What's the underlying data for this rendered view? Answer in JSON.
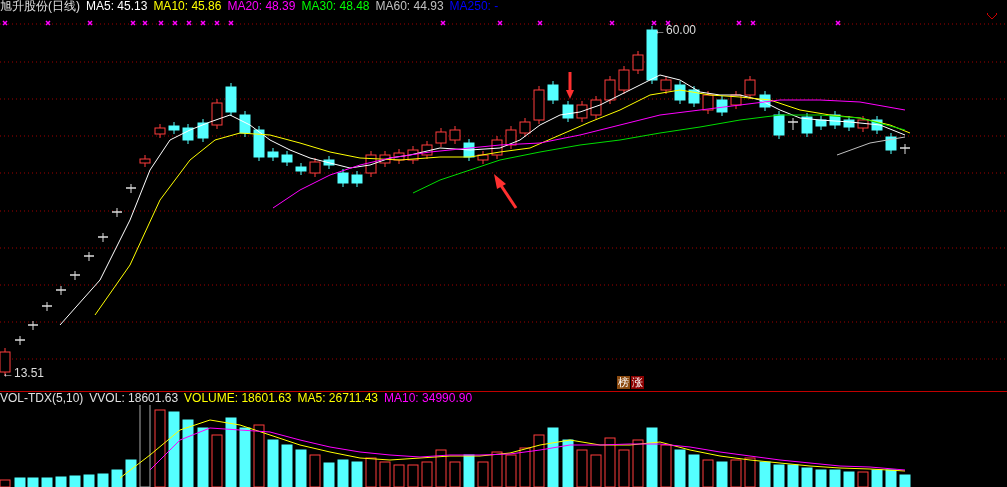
{
  "price_panel": {
    "title": "旭升股份(日线)",
    "indicators": [
      {
        "label": "MA5: 45.13",
        "color": "#ffffff"
      },
      {
        "label": "MA10: 45.86",
        "color": "#ffff00"
      },
      {
        "label": "MA20: 48.39",
        "color": "#ff00ff"
      },
      {
        "label": "MA30: 48.48",
        "color": "#00ff00"
      },
      {
        "label": "MA60: 44.93",
        "color": "#c0c0c0"
      },
      {
        "label": "MA250: -",
        "color": "#0000ff"
      }
    ],
    "high_label": "←60.00",
    "low_label": "←13.51",
    "badges": [
      {
        "text": "榜",
        "color": "#8b4a10"
      },
      {
        "text": "涨",
        "color": "#8b0000"
      }
    ]
  },
  "volume_panel": {
    "title": "VOL-TDX(5,10)",
    "value": "VVOL: 18601.63",
    "indicators": [
      {
        "label": "VOLUME: 18601.63",
        "color": "#ffff00"
      },
      {
        "label": "MA5: 26711.43",
        "color": "#ffff00"
      },
      {
        "label": "MA10: 34990.90",
        "color": "#ff00ff"
      }
    ]
  }
}
